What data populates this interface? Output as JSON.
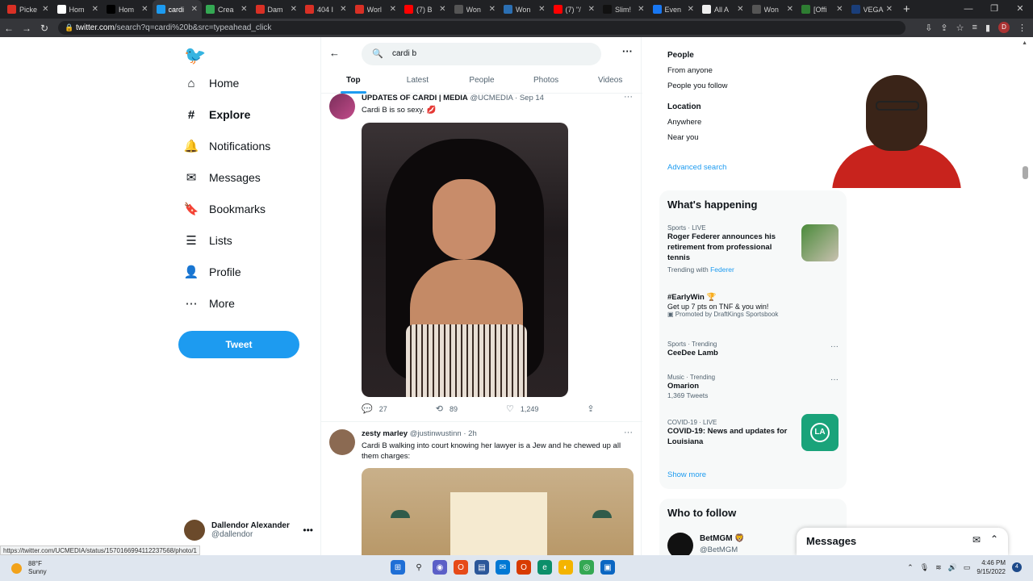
{
  "browser": {
    "tabs": [
      {
        "label": "Picke",
        "color": "#d93025"
      },
      {
        "label": "Hom",
        "color": "#ffffff"
      },
      {
        "label": "Hom",
        "color": "#000000"
      },
      {
        "label": "cardi",
        "color": "#1d9bf0",
        "active": true
      },
      {
        "label": "Crea",
        "color": "#34a853"
      },
      {
        "label": "Dam",
        "color": "#d93025"
      },
      {
        "label": "404 I",
        "color": "#d93025"
      },
      {
        "label": "Worl",
        "color": "#d93025"
      },
      {
        "label": "(7) B",
        "color": "#ff0000"
      },
      {
        "label": "Won",
        "color": "#555555"
      },
      {
        "label": "Won",
        "color": "#2b6fb3"
      },
      {
        "label": "(7) \"/",
        "color": "#ff0000"
      },
      {
        "label": "Slim!",
        "color": "#111111"
      },
      {
        "label": "Even",
        "color": "#1877f2"
      },
      {
        "label": "All A",
        "color": "#eeeeee"
      },
      {
        "label": "Won",
        "color": "#555555"
      },
      {
        "label": "[Offi",
        "color": "#2e7d32"
      },
      {
        "label": "VEGA",
        "color": "#1a3e7a"
      }
    ],
    "new_tab": "+",
    "url_domain": "twitter.com",
    "url_path": "/search?q=cardi%20b&src=typeahead_click",
    "profile_initial": "D",
    "status_url": "https://twitter.com/UCMEDIA/status/1570166994112237568/photo/1"
  },
  "sidebar": {
    "items": [
      {
        "label": "Home",
        "icon": "home-icon",
        "glyph": "⌂"
      },
      {
        "label": "Explore",
        "icon": "hashtag-icon",
        "glyph": "#",
        "bold": true
      },
      {
        "label": "Notifications",
        "icon": "bell-icon",
        "glyph": "🔔"
      },
      {
        "label": "Messages",
        "icon": "envelope-icon",
        "glyph": "✉"
      },
      {
        "label": "Bookmarks",
        "icon": "bookmark-icon",
        "glyph": "🔖"
      },
      {
        "label": "Lists",
        "icon": "list-icon",
        "glyph": "☰"
      },
      {
        "label": "Profile",
        "icon": "person-icon",
        "glyph": "👤"
      },
      {
        "label": "More",
        "icon": "more-circle-icon",
        "glyph": "⋯"
      }
    ],
    "tweet_label": "Tweet",
    "user": {
      "name": "Dallendor Alexander",
      "handle": "@dallendor"
    }
  },
  "search": {
    "query": "cardi b",
    "tabs": [
      "Top",
      "Latest",
      "People",
      "Photos",
      "Videos"
    ],
    "active_tab": "Top"
  },
  "tweets": [
    {
      "name": "UPDATES OF CARDI | MEDIA",
      "handle": "@UCMEDIA",
      "time": "· Sep 14",
      "text": "Cardi B is so sexy. 💋",
      "replies": "27",
      "retweets": "89",
      "likes": "1,249"
    },
    {
      "name": "zesty marley",
      "handle": "@justinwustinn",
      "time": "· 2h",
      "text": "Cardi B walking into court knowing her lawyer is a Jew and he chewed up all them charges:"
    }
  ],
  "filters": {
    "people_heading": "People",
    "people_opts": [
      "From anyone",
      "People you follow"
    ],
    "location_heading": "Location",
    "location_opts": [
      "Anywhere",
      "Near you"
    ],
    "advanced": "Advanced search"
  },
  "happening": {
    "title": "What's happening",
    "trends": [
      {
        "meta": "Sports · LIVE",
        "title": "Roger Federer announces his retirement from professional tennis",
        "sub_prefix": "Trending with",
        "sub_link": "Federer"
      },
      {
        "meta": "",
        "title": "#EarlyWin 🏆",
        "desc": "Get up 7 pts on TNF & you win!",
        "sub_prefix": "Promoted by DraftKings Sportsbook"
      },
      {
        "meta": "Sports · Trending",
        "title": "CeeDee Lamb"
      },
      {
        "meta": "Music · Trending",
        "title": "Omarion",
        "sub_prefix": "1,369 Tweets"
      },
      {
        "meta": "COVID-19 · LIVE",
        "title": "COVID-19: News and updates for Louisiana"
      }
    ],
    "show_more": "Show more"
  },
  "who_to_follow": {
    "title": "Who to follow",
    "user": {
      "name": "BetMGM 🦁",
      "handle": "@BetMGM"
    }
  },
  "messages_dock": {
    "label": "Messages"
  },
  "taskbar": {
    "temp": "88°F",
    "condition": "Sunny",
    "time": "4:46 PM",
    "date": "9/15/2022",
    "notifications": "4"
  },
  "colors": {
    "accent": "#1d9bf0",
    "text": "#0f1419",
    "muted": "#536471"
  }
}
